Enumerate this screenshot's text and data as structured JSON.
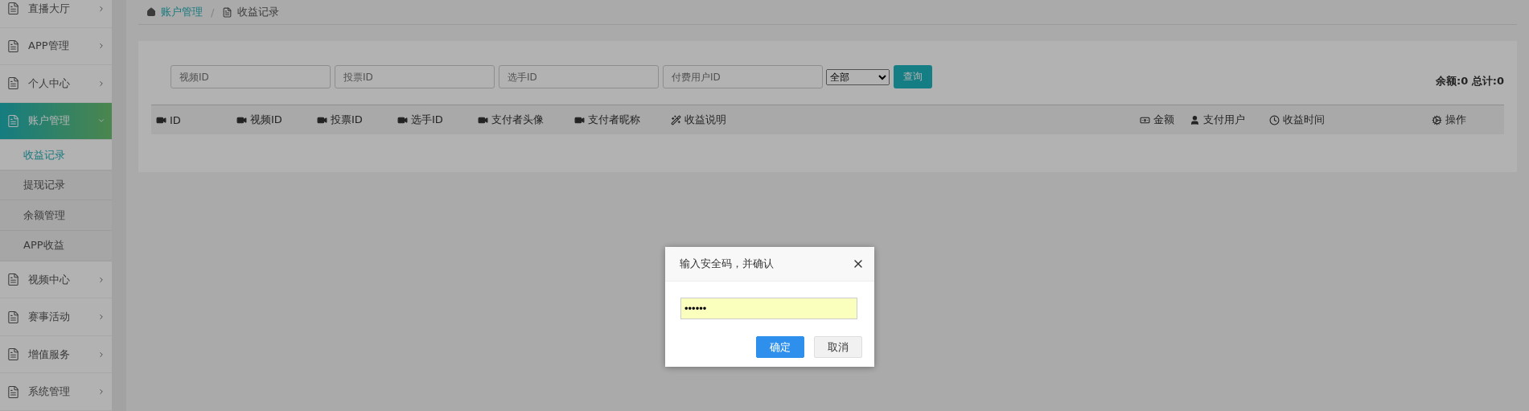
{
  "sidebar": {
    "items": [
      {
        "label": "直播大厅",
        "selected": false,
        "expanded": false
      },
      {
        "label": "APP管理",
        "selected": false,
        "expanded": false
      },
      {
        "label": "个人中心",
        "selected": false,
        "expanded": false
      },
      {
        "label": "账户管理",
        "selected": true,
        "expanded": true,
        "children": [
          {
            "label": "收益记录",
            "selected": true
          },
          {
            "label": "提现记录",
            "selected": false
          },
          {
            "label": "余额管理",
            "selected": false
          },
          {
            "label": "APP收益",
            "selected": false
          }
        ]
      },
      {
        "label": "视频中心",
        "selected": false,
        "expanded": false
      },
      {
        "label": "赛事活动",
        "selected": false,
        "expanded": false
      },
      {
        "label": "增值服务",
        "selected": false,
        "expanded": false
      },
      {
        "label": "系统管理",
        "selected": false,
        "expanded": false
      }
    ]
  },
  "breadcrumb": {
    "items": [
      {
        "label": "账户管理",
        "kind": "home"
      },
      {
        "label": "收益记录",
        "kind": "page"
      }
    ],
    "separator": "/"
  },
  "filters": {
    "fields": [
      {
        "placeholder": "视频ID"
      },
      {
        "placeholder": "投票ID"
      },
      {
        "placeholder": "选手ID"
      },
      {
        "placeholder": "付费用户ID"
      }
    ],
    "select": {
      "value": "全部"
    },
    "search_button": "查询",
    "summary": "余额:0 总计:0"
  },
  "table": {
    "columns": [
      {
        "label": "ID",
        "kind": "video"
      },
      {
        "label": "视频ID",
        "kind": "video"
      },
      {
        "label": "投票ID",
        "kind": "video"
      },
      {
        "label": "选手ID",
        "kind": "video"
      },
      {
        "label": "支付者头像",
        "kind": "video"
      },
      {
        "label": "支付者昵称",
        "kind": "video"
      },
      {
        "label": "收益说明",
        "kind": "wand"
      },
      {
        "label": "金额",
        "kind": "money"
      },
      {
        "label": "支付用户",
        "kind": "user"
      },
      {
        "label": "收益时间",
        "kind": "clock"
      },
      {
        "label": "操作",
        "kind": "cogs"
      }
    ]
  },
  "dialog": {
    "title": "输入安全码，并确认",
    "value": "••••••",
    "buttons": [
      {
        "label": "确定",
        "kind": "primary"
      },
      {
        "label": "取消",
        "kind": "default"
      }
    ]
  }
}
